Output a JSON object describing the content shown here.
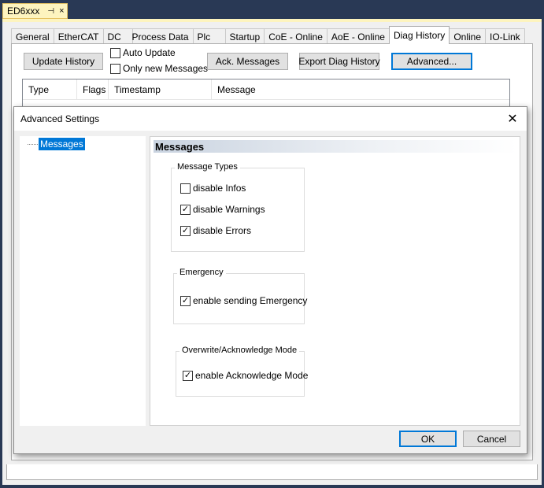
{
  "document": {
    "tab_title": "ED6xxx",
    "pin_glyph": "⊣",
    "close_glyph": "×"
  },
  "tabs": [
    {
      "label": "General"
    },
    {
      "label": "EtherCAT"
    },
    {
      "label": "DC"
    },
    {
      "label": "Process Data"
    },
    {
      "label": "Plc"
    },
    {
      "label": "Startup"
    },
    {
      "label": "CoE - Online"
    },
    {
      "label": "AoE - Online"
    },
    {
      "label": "Diag History"
    },
    {
      "label": "Online"
    },
    {
      "label": "IO-Link"
    }
  ],
  "active_tab": "Diag History",
  "toolbar": {
    "update_history": "Update History",
    "auto_update": "Auto Update",
    "only_new_messages": "Only new Messages",
    "ack_messages": "Ack. Messages",
    "export_diag_history": "Export Diag History",
    "advanced": "Advanced..."
  },
  "list": {
    "columns": [
      "Type",
      "Flags",
      "Timestamp",
      "Message"
    ]
  },
  "dialog": {
    "title": "Advanced Settings",
    "close_glyph": "✕",
    "tree": {
      "items": [
        {
          "label": "Messages",
          "selected": true
        }
      ]
    },
    "section_title": "Messages",
    "groups": {
      "message_types": {
        "title": "Message Types",
        "options": [
          {
            "label": "disable Infos",
            "checked": false
          },
          {
            "label": "disable Warnings",
            "checked": true
          },
          {
            "label": "disable Errors",
            "checked": true
          }
        ]
      },
      "emergency": {
        "title": "Emergency",
        "options": [
          {
            "label": "enable sending Emergency",
            "checked": true
          }
        ]
      },
      "overwrite": {
        "title": "Overwrite/Acknowledge Mode",
        "options": [
          {
            "label": "enable Acknowledge Mode",
            "checked": true
          }
        ]
      }
    },
    "ok_label": "OK",
    "cancel_label": "Cancel"
  },
  "check_glyph": "✓",
  "colors": {
    "selection": "#0078d7",
    "document_tab": "#fdf4bf",
    "frame": "#293955"
  }
}
